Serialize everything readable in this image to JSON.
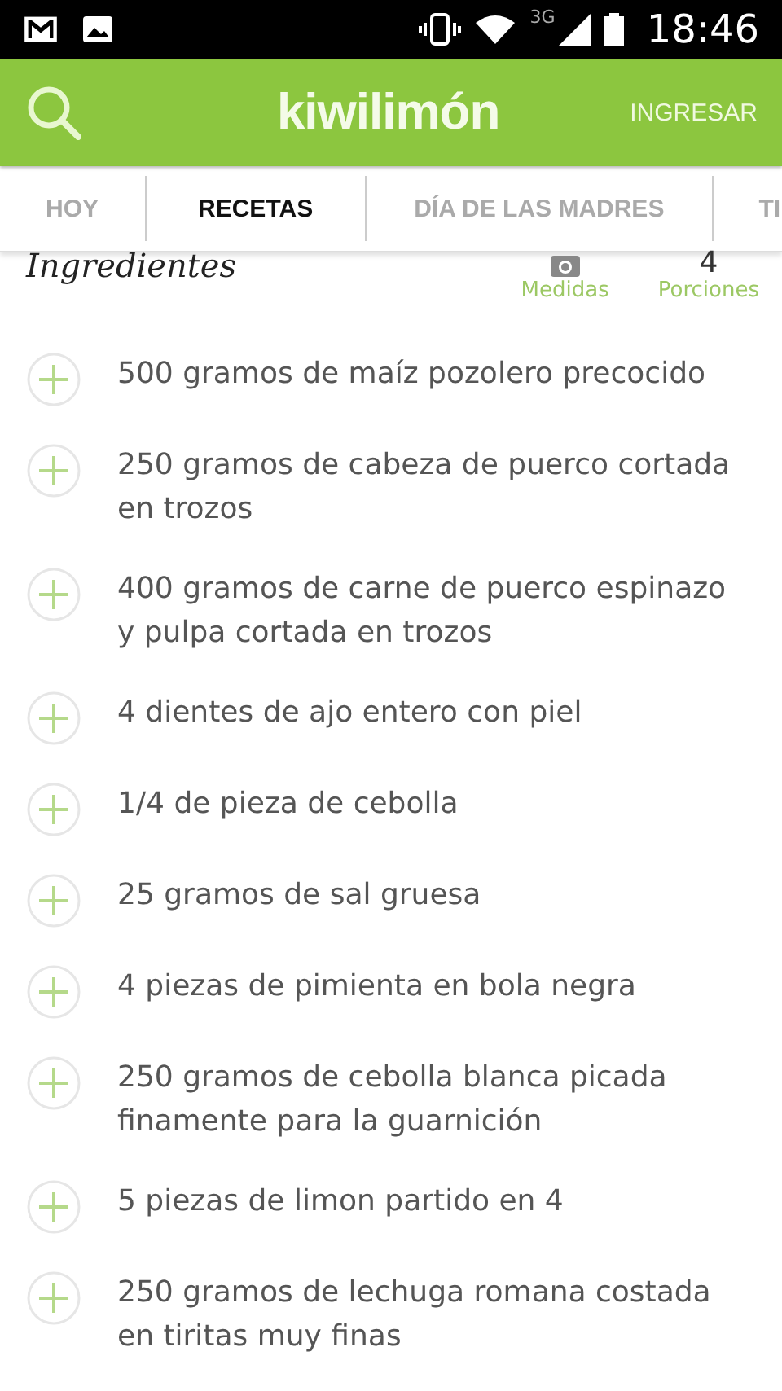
{
  "status_bar": {
    "time": "18:46",
    "network": "3G"
  },
  "header": {
    "logo": "kiwilimón",
    "login": "INGRESAR"
  },
  "tabs": [
    {
      "label": "HOY",
      "selected": false
    },
    {
      "label": "RECETAS",
      "selected": true
    },
    {
      "label": "DÍA DE LAS MADRES",
      "selected": false
    },
    {
      "label": "TI",
      "selected": false
    }
  ],
  "section": {
    "title": "Ingredientes",
    "measures_label": "Medidas",
    "portions_value": "4",
    "portions_label": "Porciones"
  },
  "ingredients": [
    {
      "text": "500 gramos de maíz pozolero precocido"
    },
    {
      "text": "250 gramos de cabeza de puerco cortada en trozos"
    },
    {
      "text": "400 gramos de carne de puerco espinazo y pulpa cortada en trozos"
    },
    {
      "text": "4 dientes de ajo entero con piel"
    },
    {
      "text": "1/4 de pieza de cebolla"
    },
    {
      "text": "25 gramos de sal gruesa"
    },
    {
      "text": "4 piezas de pimienta en bola negra"
    },
    {
      "text": "250 gramos de cebolla blanca picada finamente para la guarnición"
    },
    {
      "text": "5 piezas de limon partido en 4"
    },
    {
      "text": "250 gramos de lechuga romana costada en tiritas muy finas"
    }
  ]
}
